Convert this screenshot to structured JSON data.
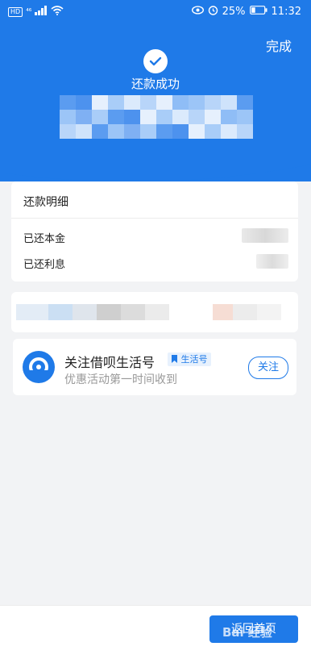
{
  "status_bar": {
    "hd": "HD",
    "network": "⁴⁶",
    "battery": "25%",
    "time": "11:32"
  },
  "header": {
    "done_label": "完成",
    "success_title": "还款成功"
  },
  "details": {
    "title": "还款明细",
    "principal_label": "已还本金",
    "interest_label": "已还利息"
  },
  "follow_card": {
    "title": "关注借呗生活号",
    "tag": "生活号",
    "subtitle": "优惠活动第一时间收到",
    "follow_label": "关注"
  },
  "bottom": {
    "home_label": "返回首页"
  },
  "watermark": {
    "text": "Bai 经验"
  },
  "colors": {
    "brand_blue": "#1f7ae8",
    "background": "#f2f3f5"
  }
}
